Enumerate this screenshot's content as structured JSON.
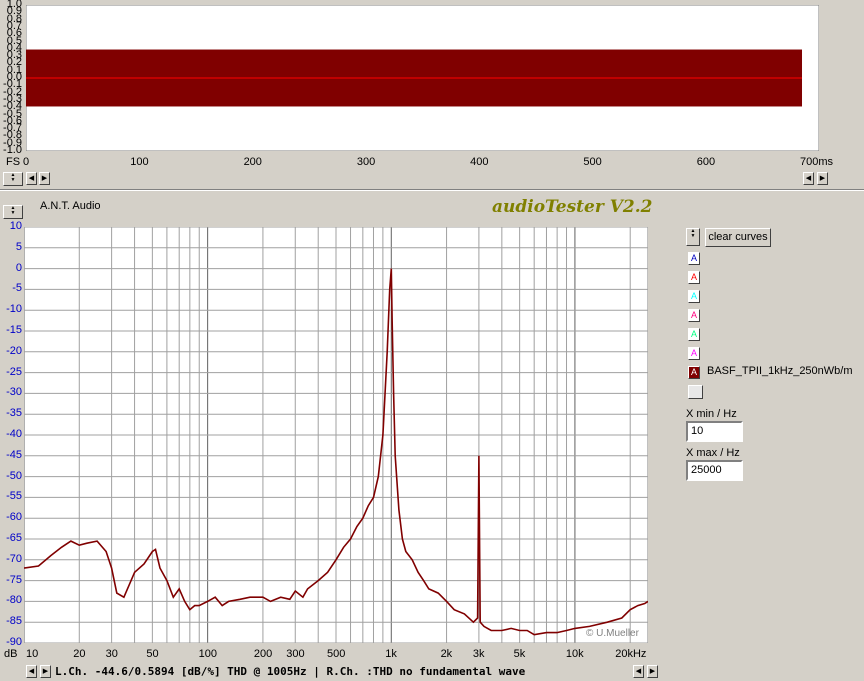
{
  "top_plot": {
    "y_ticks": [
      "1.0",
      "0.9",
      "0.8",
      "0.7",
      "0.6",
      "0.5",
      "0.4",
      "0.3",
      "0.2",
      "0.1",
      "0.0",
      "-0.1",
      "-0.2",
      "-0.3",
      "-0.4",
      "-0.5",
      "-0.6",
      "-0.7",
      "-0.8",
      "-0.9",
      "-1.0"
    ],
    "y_label": "FS",
    "x_ticks": [
      "0",
      "100",
      "200",
      "300",
      "400",
      "500",
      "600"
    ],
    "x_unit": "700ms",
    "waveform_color": "#800000",
    "trace_color": "#ff0000"
  },
  "header": {
    "company": "A.N.T. Audio",
    "app_title": "audioTester V2.2"
  },
  "bottom_plot": {
    "y_label": "dB",
    "x_tick_labels": [
      "10",
      "20",
      "30",
      "50",
      "100",
      "200",
      "300",
      "500",
      "1k",
      "2k",
      "3k",
      "5k",
      "10k",
      "20kHz"
    ],
    "copyright": "© U.Mueller",
    "status_text": "L.Ch. -44.6/0.5894 [dB/%] THD @ 1005Hz  |  R.Ch. :THD no fundamental wave"
  },
  "side_panel": {
    "clear_button": "clear curves",
    "swatches": [
      {
        "letter": "A",
        "color": "#0000c0",
        "fill": "#ffffff",
        "label": ""
      },
      {
        "letter": "A",
        "color": "#ff0000",
        "fill": "#ffffff",
        "label": ""
      },
      {
        "letter": "A",
        "color": "#00ffff",
        "fill": "#ffffff",
        "label": ""
      },
      {
        "letter": "A",
        "color": "#ff0080",
        "fill": "#ffffff",
        "label": ""
      },
      {
        "letter": "A",
        "color": "#00ff80",
        "fill": "#ffffff",
        "label": ""
      },
      {
        "letter": "A",
        "color": "#ff00ff",
        "fill": "#ffffff",
        "label": ""
      },
      {
        "letter": "A",
        "color": "#800000",
        "fill": "#800000",
        "label": "BASF_TPII_1kHz_250nWb/m"
      }
    ],
    "xmin_label": "X min / Hz",
    "xmin_value": "10",
    "xmax_label": "X max / Hz",
    "xmax_value": "25000"
  },
  "chart_data": [
    {
      "type": "line",
      "title": "",
      "xlabel": "ms",
      "ylabel": "FS",
      "xlim": [
        0,
        700
      ],
      "ylim": [
        -1.0,
        1.0
      ],
      "series": [
        {
          "x": [
            0,
            685
          ],
          "y_max": [
            0.39,
            0.39
          ],
          "y_min": [
            -0.39,
            -0.39
          ]
        }
      ]
    },
    {
      "type": "line",
      "title": "",
      "xlabel": "Hz",
      "ylabel": "dB",
      "x_scale": "log",
      "xlim": [
        10,
        25000
      ],
      "ylim": [
        -90,
        10
      ],
      "y_ticks": [
        10,
        5,
        0,
        -5,
        -10,
        -15,
        -20,
        -25,
        -30,
        -35,
        -40,
        -45,
        -50,
        -55,
        -60,
        -65,
        -70,
        -75,
        -80,
        -85,
        -90
      ],
      "series": [
        {
          "name": "BASF_TPII_1kHz_250nWb/m",
          "x": [
            10,
            12,
            14,
            16,
            18,
            20,
            22,
            25,
            28,
            30,
            32,
            35,
            40,
            45,
            50,
            52,
            55,
            60,
            65,
            70,
            75,
            80,
            85,
            90,
            100,
            110,
            120,
            130,
            150,
            170,
            200,
            220,
            250,
            280,
            300,
            330,
            350,
            400,
            450,
            500,
            550,
            600,
            650,
            700,
            750,
            800,
            850,
            900,
            950,
            980,
            1000,
            1010,
            1030,
            1050,
            1100,
            1150,
            1200,
            1300,
            1400,
            1500,
            1600,
            1800,
            2000,
            2200,
            2500,
            2800,
            2950,
            3000,
            3050,
            3200,
            3500,
            4000,
            4500,
            5000,
            5500,
            6000,
            7000,
            8000,
            9000,
            10000,
            12000,
            15000,
            18000,
            20000,
            22000,
            24000,
            25000
          ],
          "y": [
            -72,
            -71.5,
            -69,
            -67,
            -65.5,
            -66.5,
            -66,
            -65.5,
            -68,
            -72,
            -78,
            -79,
            -73,
            -71,
            -68,
            -67.5,
            -72,
            -75,
            -79,
            -77,
            -80,
            -82,
            -81,
            -81,
            -80,
            -79,
            -81,
            -80,
            -79.5,
            -79,
            -79,
            -80,
            -79,
            -79.5,
            -77.5,
            -79,
            -77,
            -75,
            -73,
            -70,
            -67,
            -65,
            -62,
            -60,
            -57,
            -55,
            -50,
            -40,
            -20,
            -5,
            0,
            -12,
            -30,
            -45,
            -58,
            -65,
            -68,
            -70,
            -73,
            -75,
            -77,
            -78,
            -80,
            -82,
            -83,
            -85,
            -84,
            -45,
            -85,
            -86,
            -87,
            -87,
            -86.5,
            -87,
            -87,
            -88,
            -87.5,
            -87.5,
            -87,
            -86.5,
            -86,
            -85,
            -84,
            -82,
            -81,
            -80.5,
            -80
          ]
        }
      ]
    }
  ]
}
